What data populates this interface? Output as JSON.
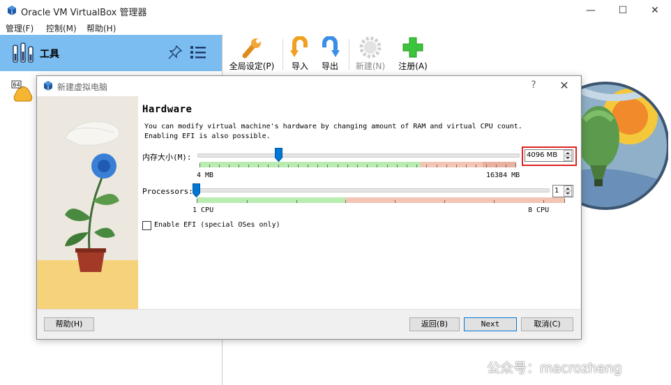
{
  "window": {
    "title": "Oracle VM VirtualBox 管理器",
    "controls": {
      "minimize": "—",
      "maximize": "☐",
      "close": "✕"
    }
  },
  "menubar": {
    "items": [
      "管理(F)",
      "控制(M)",
      "帮助(H)"
    ]
  },
  "sidebar": {
    "tools_label": "工具",
    "vm_badge": "64"
  },
  "toolbar": {
    "buttons": [
      {
        "label": "全局设定(P)",
        "icon": "wrench-icon"
      },
      {
        "label": "导入",
        "icon": "import-icon"
      },
      {
        "label": "导出",
        "icon": "export-icon"
      },
      {
        "label": "新建(N)",
        "icon": "new-gear-icon"
      },
      {
        "label": "注册(A)",
        "icon": "add-plus-icon"
      }
    ]
  },
  "dialog": {
    "title": "新建虚拟电脑",
    "help_glyph": "?",
    "close_glyph": "✕",
    "heading": "Hardware",
    "description_line1": "You can modify virtual machine's hardware by changing amount of RAM and virtual CPU count.",
    "description_line2": "Enabling EFI is also possible.",
    "memory": {
      "label": "内存大小(M):",
      "value": "4096 MB",
      "min_label": "4 MB",
      "max_label": "16384 MB",
      "fraction": 0.25
    },
    "processors": {
      "label": "Processors:",
      "value": "1",
      "min_label": "1 CPU",
      "max_label": "8 CPU",
      "fraction": 0.0
    },
    "efi": {
      "label": "Enable EFI (special OSes only)",
      "checked": false
    },
    "buttons": {
      "help": "帮助(H)",
      "back": "返回(B)",
      "next": "Next",
      "cancel": "取消(C)"
    }
  },
  "watermark": "公众号：macrozheng",
  "colors": {
    "selection": "#7bbdf0",
    "highlight_box": "#e02020",
    "slider_thumb": "#0078d7",
    "scale_green": "#b8ecb0",
    "scale_red": "#f4c4b4"
  }
}
